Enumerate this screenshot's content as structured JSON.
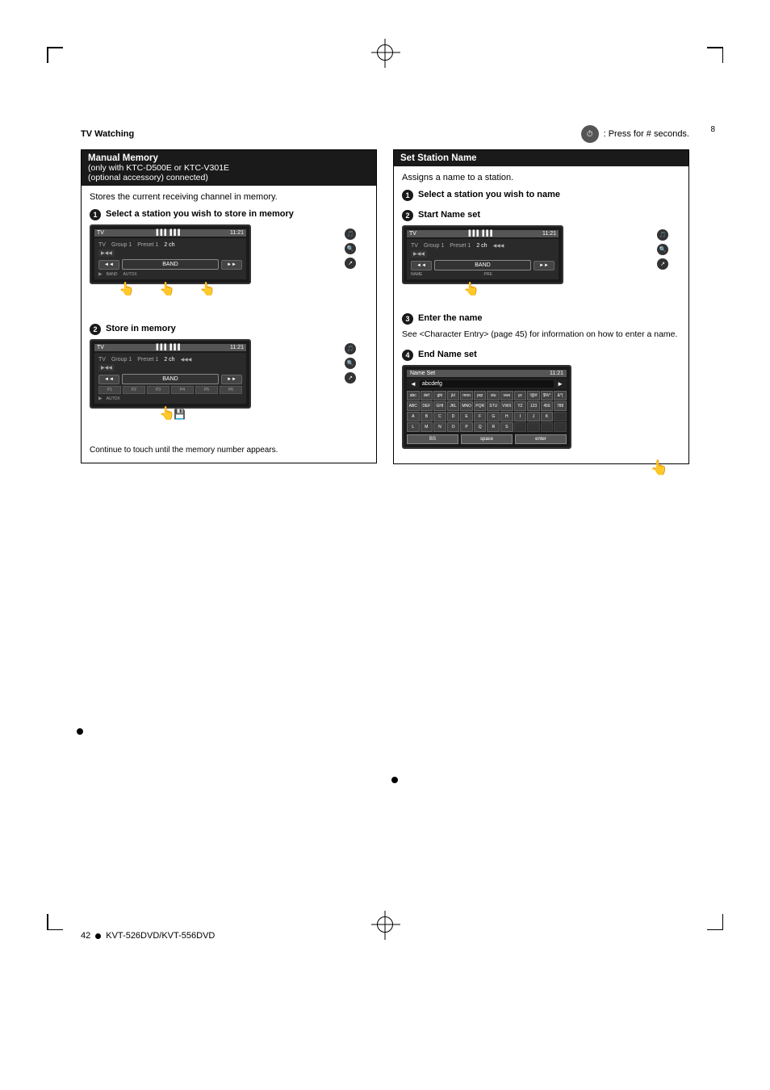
{
  "page": {
    "number": "8",
    "header_left": "TV Watching",
    "header_right": ": Press for # seconds.",
    "timer_icon": "⏱"
  },
  "left_section": {
    "title": "Manual Memory",
    "subtitle1": "(only with KTC-D500E or KTC-V301E",
    "subtitle2": "(optional accessory) connected)",
    "stores_text": "Stores the current receiving channel in memory.",
    "step1": {
      "num": "1",
      "label": "Select a station you wish to store in memory"
    },
    "step2": {
      "num": "2",
      "label": "Store in memory"
    },
    "note": "Continue to touch until the memory number appears."
  },
  "right_section": {
    "title": "Set Station Name",
    "assigns_text": "Assigns a name to a station.",
    "step1": {
      "num": "1",
      "label": "Select a station you wish to name"
    },
    "step2": {
      "num": "2",
      "label": "Start Name set"
    },
    "step3": {
      "num": "3",
      "label": "Enter the name"
    },
    "step3_desc": "See <Character Entry> (page 45) for information on how to enter a name.",
    "step4": {
      "num": "4",
      "label": "End Name set"
    }
  },
  "screen": {
    "tv_label": "TV",
    "group": "Group 1",
    "preset": "Preset 1",
    "ch": "2 ch",
    "time": "11:21",
    "band_btn": "BAND",
    "name_btn": "NAME",
    "pre_btn": "PRE",
    "prev_btn": "◄◄",
    "next_btn": "►►",
    "key_chars": "abcdefg",
    "keys_row1": [
      "abc",
      "def",
      "ghi",
      "jkl",
      "mno",
      "pqr",
      "stu",
      "vwx",
      "yz ",
      "!@#",
      "$%^",
      "&*("
    ],
    "keys_row2": [
      "ABC",
      "DEF",
      "GHI",
      "JKL",
      "MNO",
      "PQR",
      "STU",
      "VWX",
      "YZ ",
      "123",
      "456",
      "789"
    ],
    "keys_row3": [
      "A",
      "B",
      "C",
      "D",
      "E",
      "F",
      "G",
      "H",
      "I",
      "J",
      "K"
    ],
    "keys_row4": [
      "L",
      "M",
      "N",
      "O",
      "P",
      "Q",
      "R",
      "S"
    ],
    "bottom_btns": [
      "BS",
      "space",
      "enter"
    ]
  },
  "footer": {
    "page_label": "42",
    "dot": "●",
    "model": "KVT-526DVD/KVT-556DVD"
  }
}
